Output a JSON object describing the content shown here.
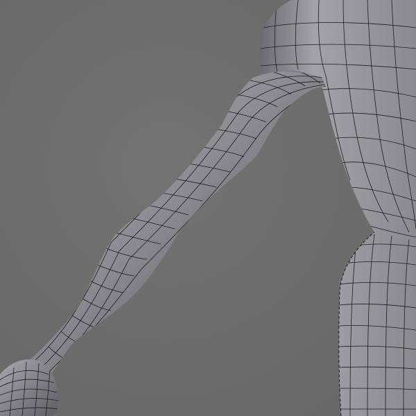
{
  "scene": {
    "background_color": "#6e6e6e",
    "mesh_base_color": "#8e8e93",
    "mesh_highlight_color": "#b4b4ba",
    "mesh_shadow_color": "#3e3e44",
    "wire_color": "#1a1a1a"
  }
}
